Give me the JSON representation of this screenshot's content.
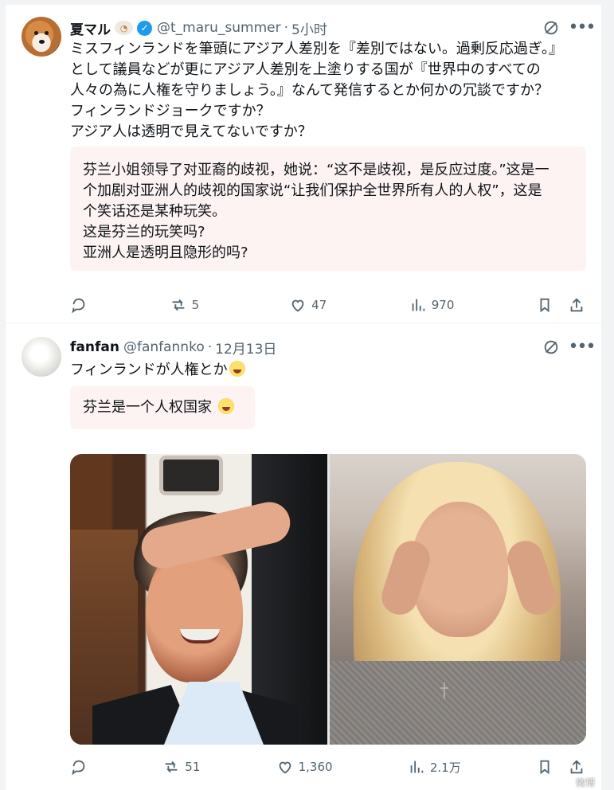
{
  "posts": [
    {
      "author": {
        "display_name": "夏マル",
        "handle": "@t_maru_summer",
        "verified": true
      },
      "time": "5小时",
      "text": "ミスフィンランドを筆頭にアジア人差別を『差別ではない。過剰反応過ぎ。』\nとして議員などが更にアジア人差別を上塗りする国が『世界中のすべての\n人々の為に人権を守りましょう。』なんて発信するとか何かの冗談ですか？\nフィンランドジョークですか？\nアジア人は透明で見えてないですか？",
      "translation": "芬兰小姐领导了对亚裔的歧视，她说：“这不是歧视，是反应过度。”这是一\n个加剧对亚洲人的歧视的国家说“让我们保护全世界所有人的人权”，这是\n个笑话还是某种玩笑。\n这是芬兰的玩笑吗?\n亚洲人是透明且隐形的吗?",
      "stats": {
        "reposts": "5",
        "likes": "47",
        "views": "970"
      }
    },
    {
      "author": {
        "display_name": "fanfan",
        "handle": "@fanfannko"
      },
      "time": "12月13日",
      "text": "フィンランドが人権とか",
      "translation": "芬兰是一个人权国家",
      "stats": {
        "reposts": "51",
        "likes": "1,360",
        "views": "2.1万"
      }
    }
  ],
  "icons": [
    "reply-icon",
    "repost-icon",
    "like-icon",
    "views-icon",
    "bookmark-icon",
    "share-icon",
    "grok-icon",
    "more-icon",
    "verified-icon"
  ],
  "watermark": "微博"
}
